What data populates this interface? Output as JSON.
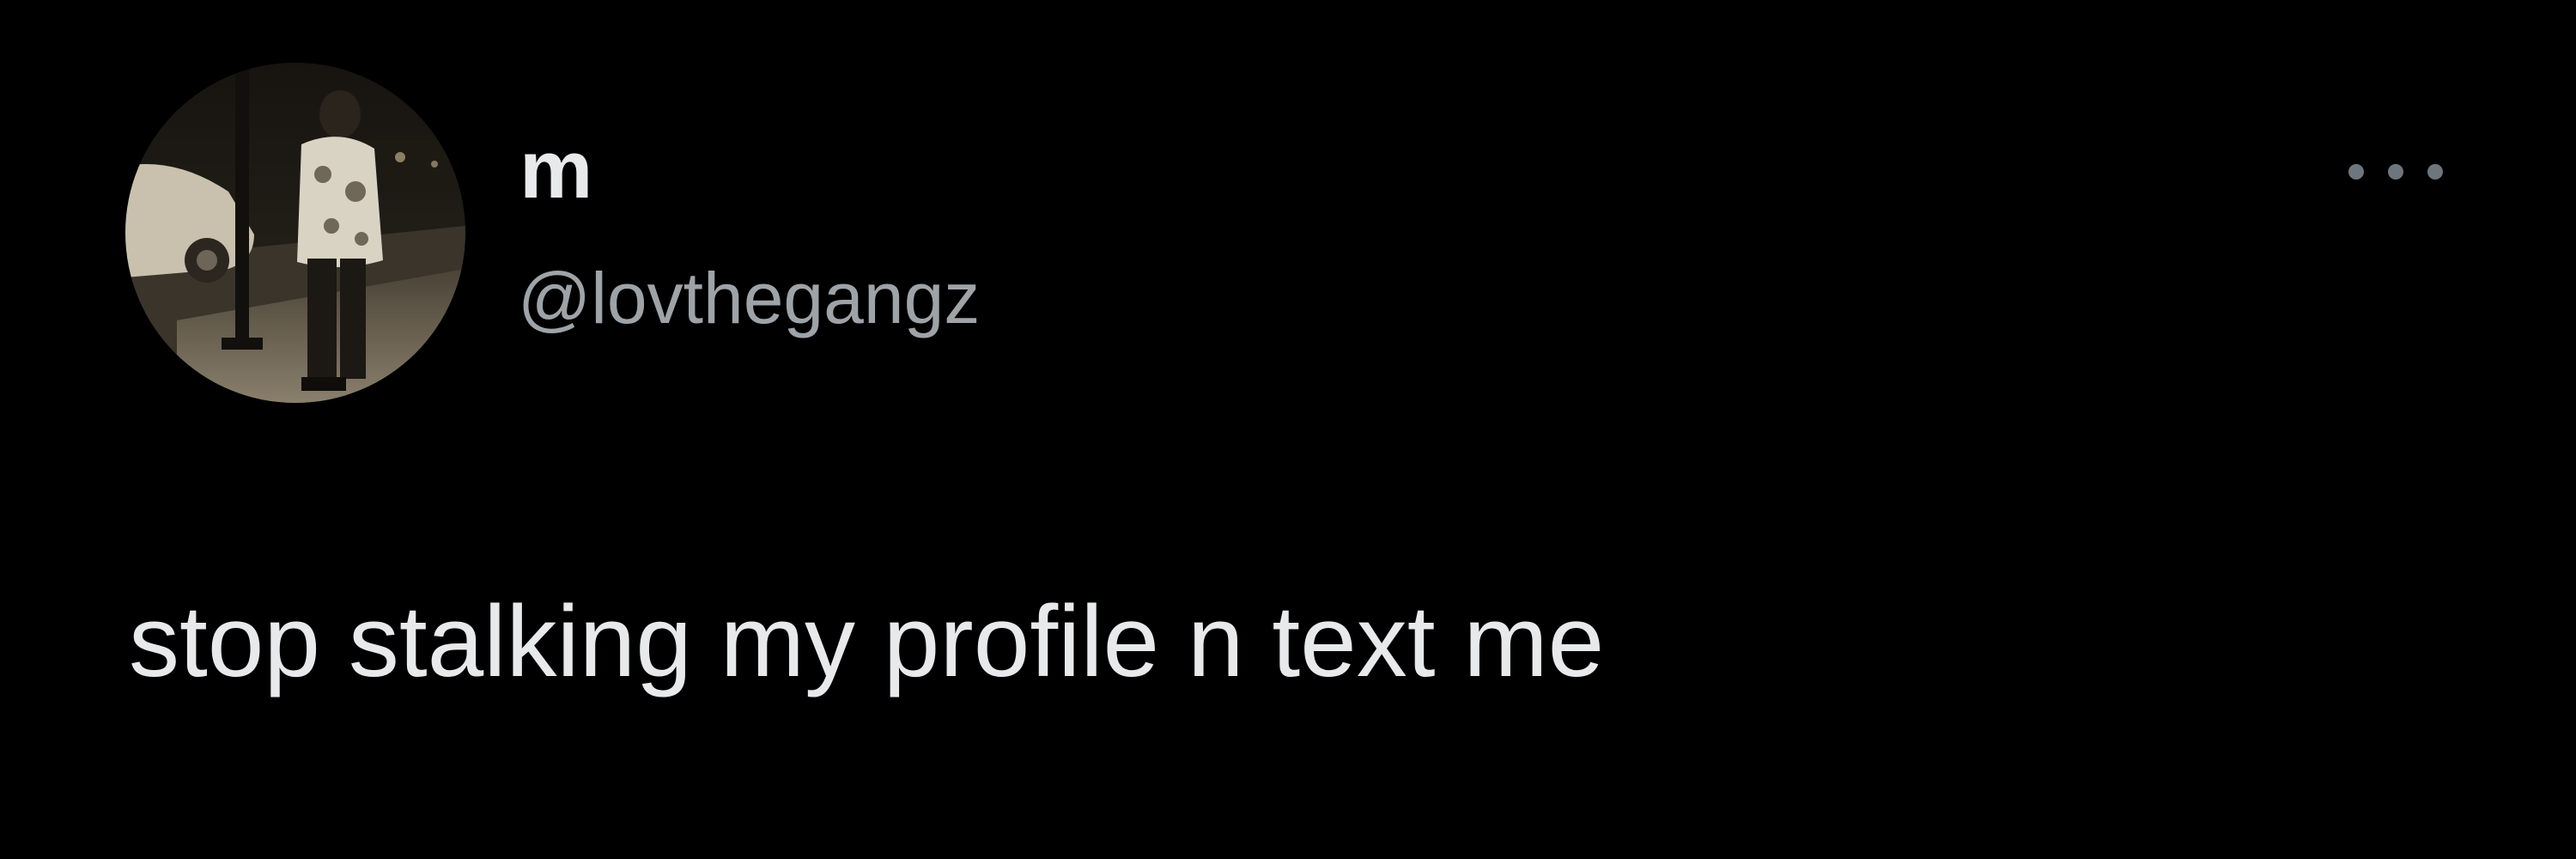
{
  "tweet": {
    "author": {
      "display_name": "m",
      "handle": "@lovthegangz",
      "avatar": "avatar-photo"
    },
    "more_icon": "more-horizontal-icon",
    "text": "stop stalking my profile n text me"
  },
  "colors": {
    "background": "#000000",
    "primary_text": "#e7e9ea",
    "secondary_text": "#9ea3a8",
    "icon": "#6e767d"
  }
}
